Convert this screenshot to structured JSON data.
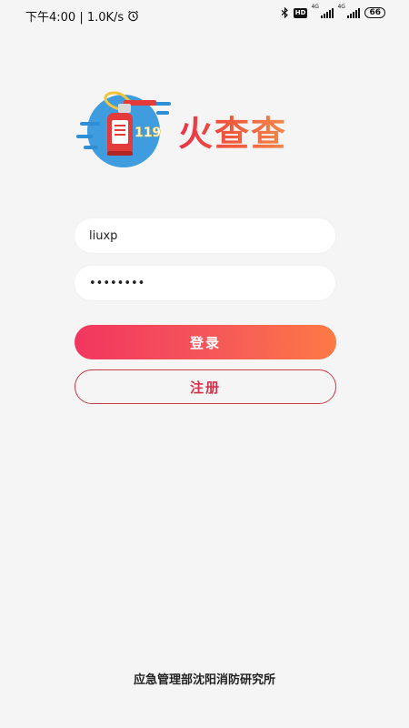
{
  "status_bar": {
    "time_text": "下午4:00 | 1.0K/s",
    "hd_label": "HD",
    "network1": "4G",
    "network2": "4G",
    "battery": "66"
  },
  "logo": {
    "badge_text": "119"
  },
  "app": {
    "title": "火查查"
  },
  "login_form": {
    "username_value": "liuxp",
    "password_value": "••••••••",
    "login_label": "登录",
    "register_label": "注册"
  },
  "footer": {
    "organization": "应急管理部沈阳消防研究所"
  },
  "colors": {
    "accent_start": "#f2365f",
    "accent_end": "#fd7a45",
    "register_border": "#c83a48",
    "logo_blue": "#2e8fd6",
    "extinguisher_red": "#e33a3a"
  }
}
